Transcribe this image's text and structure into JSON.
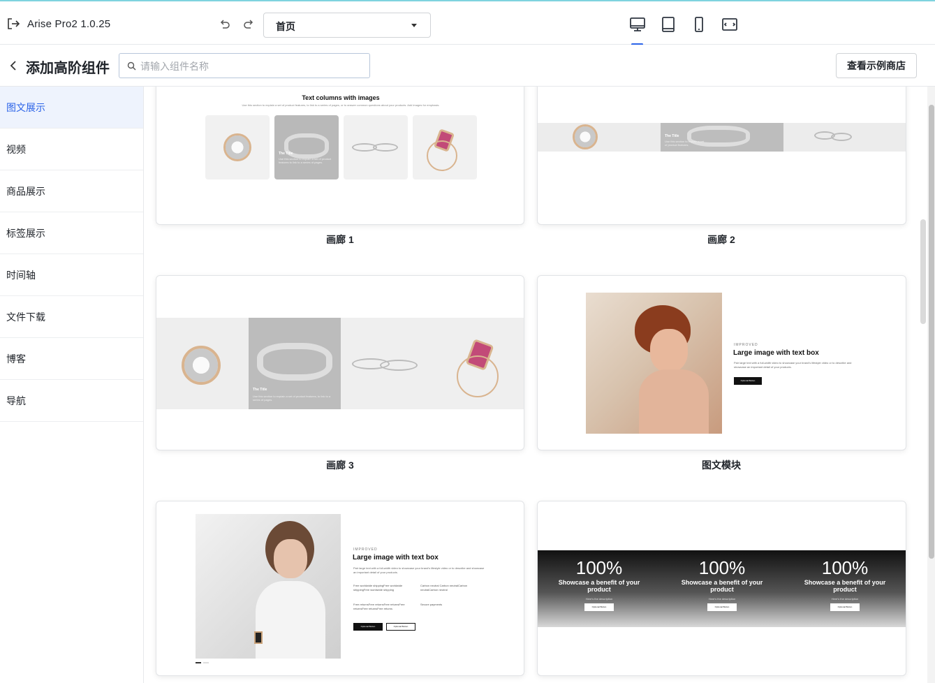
{
  "app": {
    "title": "Arise Pro2  1.0.25"
  },
  "toolbar": {
    "page_select": "首页"
  },
  "header": {
    "title": "添加高阶组件",
    "search_placeholder": "请输入组件名称",
    "store_button": "查看示例商店"
  },
  "sidebar": {
    "items": [
      {
        "label": "图文展示",
        "active": true
      },
      {
        "label": "视频"
      },
      {
        "label": "商品展示"
      },
      {
        "label": "标签展示"
      },
      {
        "label": "时间轴"
      },
      {
        "label": "文件下载"
      },
      {
        "label": "博客"
      },
      {
        "label": "导航"
      }
    ]
  },
  "cards": [
    {
      "caption": "画廊 1",
      "preview": {
        "heading": "Text columns with images",
        "sub": "Use this section to explain a set of product features, to link to a series of pages, or to answer common questions about your products. Add images for emphasis.",
        "overlay_title": "The Title",
        "overlay_text": "Use this section to explain a set of product features to link to a series of pages."
      }
    },
    {
      "caption": "画廊 2",
      "preview": {
        "overlay_title": "The Title",
        "overlay_text": "Use this section to explain a set of product features."
      }
    },
    {
      "caption": "画廊 3",
      "preview": {
        "overlay_title": "The Title",
        "overlay_text": "Use this section to explain a set of product features, to link to a series of pages."
      }
    },
    {
      "caption": "图文模块",
      "preview": {
        "eyebrow": "IMPROVED",
        "heading": "Large image with text box",
        "text": "Pair large text with a full-width video to showcase your brand's lifestyle video or to describe and showcase an important detail of your products.",
        "button": "Optional Button"
      }
    },
    {
      "caption": "",
      "preview": {
        "eyebrow": "IMPROVED",
        "heading": "Large image with text box",
        "text": "Pair large text with a full-width video to showcase your brand's lifestyle video or to describe and showcase an important detail of your products.",
        "features": [
          "Free worldwide shippingFree worldwide shippingFree worldwide shipping",
          "Carbon neutral Carbon neutralCarbon neutralCarbon neutral",
          "Free returnsFree returnsFree returnsFree returnsFree returnsFree returns",
          "Secure payments"
        ],
        "button1": "Optional Button",
        "button2": "Optional Button"
      }
    },
    {
      "caption": "",
      "preview": {
        "stats": [
          {
            "value": "100%",
            "label": "Showcase a benefit of your product",
            "desc": "Here's the description",
            "button": "Optional Button"
          },
          {
            "value": "100%",
            "label": "Showcase a benefit of your product",
            "desc": "Here's the description",
            "button": "Optional Button"
          },
          {
            "value": "100%",
            "label": "Showcase a benefit of your product",
            "desc": "Here's the description",
            "button": "Optional Button"
          }
        ]
      }
    }
  ]
}
